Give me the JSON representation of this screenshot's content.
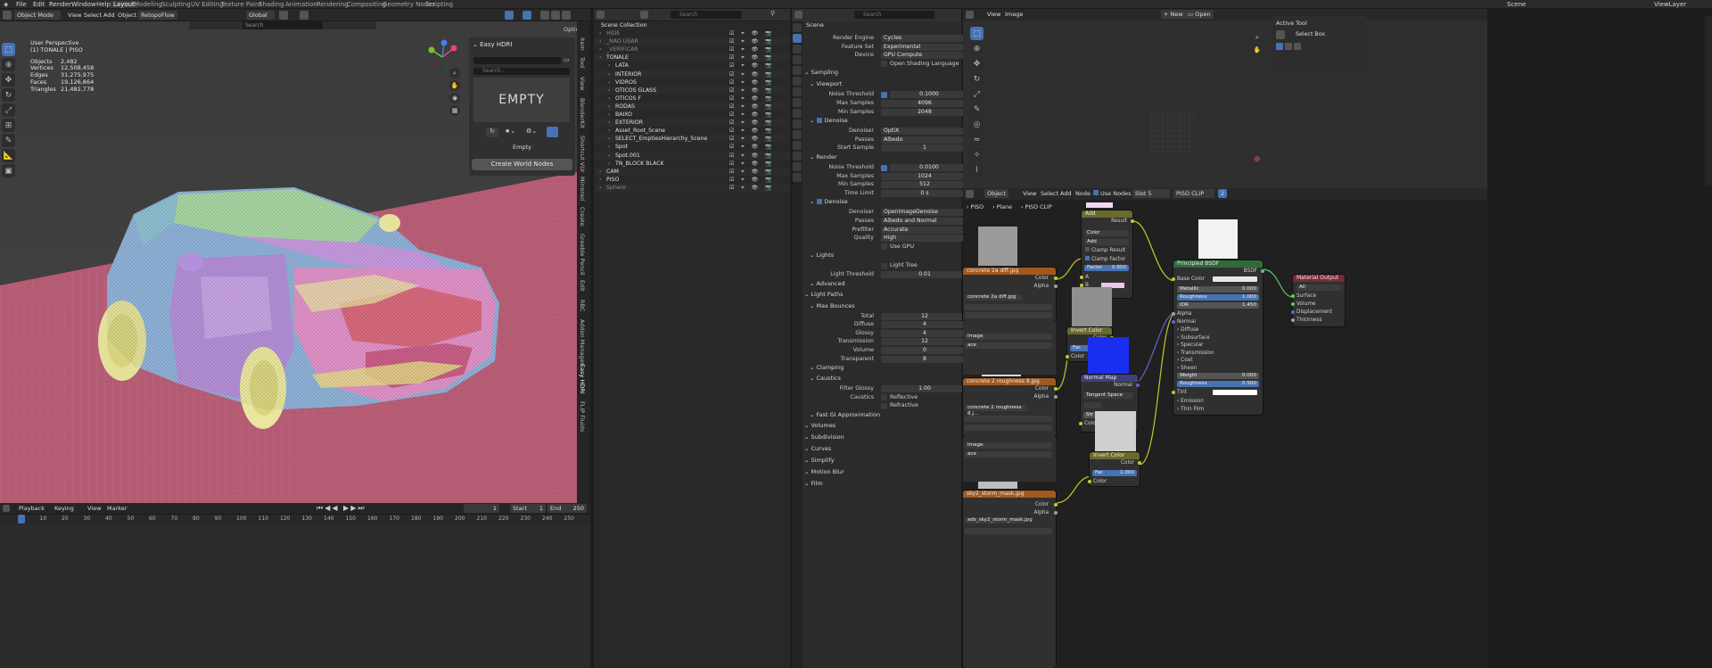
{
  "topbar": {
    "menus": [
      "File",
      "Edit",
      "Render",
      "Window",
      "Help"
    ],
    "tabs": [
      "Layout",
      "Modeling",
      "Sculpting",
      "UV Editing",
      "Texture Paint",
      "Shading",
      "Animation",
      "Rendering",
      "Compositing",
      "Geometry Nodes",
      "Scripting"
    ],
    "active_tab": "Layout",
    "scene": "Scene",
    "view_layer": "ViewLayer"
  },
  "viewport": {
    "mode": "Object Mode",
    "menus": [
      "View",
      "Select",
      "Add",
      "Object"
    ],
    "addon": "RetopoFlow",
    "orientation": "Global",
    "perspective": "User Perspective",
    "collection": "(1) TONALE | PISO",
    "stats": [
      {
        "k": "Objects",
        "v": "2,482"
      },
      {
        "k": "Vertices",
        "v": "12,508,458"
      },
      {
        "k": "Edges",
        "v": "31,275,975"
      },
      {
        "k": "Faces",
        "v": "19,126,864"
      },
      {
        "k": "Triangles",
        "v": "21,482,778"
      }
    ],
    "options": "Options",
    "hdri": {
      "title": "Easy HDRI",
      "search_placeholder": "Search...",
      "preview_text": "EMPTY",
      "name": "Empty",
      "button": "Create World Nodes"
    },
    "side_tabs": [
      "Item",
      "Tool",
      "View",
      "BlenderKit",
      "Shortcut VUr",
      "Mirrored",
      "Create",
      "Greeble Pencil",
      "Edit",
      "RBC",
      "Addon Manager",
      "Easy HDRI",
      "FLIP Fluids"
    ],
    "colors": {
      "mesh_floor": "#d06a8a",
      "accent": "#4772b3"
    }
  },
  "timeline": {
    "menus": [
      "Playback",
      "Keying",
      "View",
      "Marker"
    ],
    "current_frame": "1",
    "start_label": "Start",
    "start": "1",
    "end_label": "End",
    "end": "250",
    "ticks": [
      "1",
      "10",
      "20",
      "30",
      "40",
      "50",
      "60",
      "70",
      "80",
      "90",
      "100",
      "110",
      "120",
      "130",
      "140",
      "150",
      "160",
      "170",
      "180",
      "190",
      "200",
      "210",
      "220",
      "230",
      "240",
      "250"
    ]
  },
  "outliner": {
    "search_placeholder": "Search",
    "root": "Scene Collection",
    "rows": [
      {
        "label": "HIDE",
        "dim": true,
        "indent": 0
      },
      {
        "label": "_NAO USAR",
        "dim": true,
        "indent": 0
      },
      {
        "label": "_VERIFICAR",
        "dim": true,
        "indent": 0
      },
      {
        "label": "TONALE",
        "dim": false,
        "indent": 0
      },
      {
        "label": "LATA",
        "dim": false,
        "indent": 1
      },
      {
        "label": "INTERIOR",
        "dim": false,
        "indent": 1
      },
      {
        "label": "VIDROS",
        "dim": false,
        "indent": 1
      },
      {
        "label": "OTICOS GLASS",
        "dim": false,
        "indent": 1
      },
      {
        "label": "OTICOS F",
        "dim": false,
        "indent": 1
      },
      {
        "label": "RODAS",
        "dim": false,
        "indent": 1
      },
      {
        "label": "BAIXO",
        "dim": false,
        "indent": 1
      },
      {
        "label": "EXTERIOR",
        "dim": false,
        "indent": 1
      },
      {
        "label": "Asset_Root_Scene",
        "dim": false,
        "indent": 1
      },
      {
        "label": "SELECT_EmptiesHierarchy_Scene",
        "dim": false,
        "indent": 1
      },
      {
        "label": "Spot",
        "dim": false,
        "indent": 1
      },
      {
        "label": "Spot.001",
        "dim": false,
        "indent": 1
      },
      {
        "label": "TN_BLOCK BLACK",
        "dim": false,
        "indent": 1
      },
      {
        "label": "CAM",
        "dim": false,
        "indent": 0
      },
      {
        "label": "PISO",
        "dim": false,
        "indent": 0
      },
      {
        "label": "Sphere",
        "dim": true,
        "indent": 0
      }
    ]
  },
  "properties": {
    "search_placeholder": "Search",
    "context": "Scene",
    "rows": [
      {
        "type": "field",
        "label": "Render Engine",
        "value": "Cycles"
      },
      {
        "type": "field",
        "label": "Feature Set",
        "value": "Experimental"
      },
      {
        "type": "field",
        "label": "Device",
        "value": "GPU Compute"
      },
      {
        "type": "check",
        "label": "Open Shading Language",
        "on": false
      },
      {
        "type": "section",
        "label": "Sampling"
      },
      {
        "type": "sub",
        "label": "Viewport"
      },
      {
        "type": "checkfield",
        "label": "Noise Threshold",
        "value": "0.1000"
      },
      {
        "type": "num",
        "label": "Max Samples",
        "value": "4096"
      },
      {
        "type": "num",
        "label": "Min Samples",
        "value": "2048"
      },
      {
        "type": "sub",
        "label": "Denoise",
        "on": true
      },
      {
        "type": "field",
        "label": "Denoiser",
        "value": "OptiX"
      },
      {
        "type": "field",
        "label": "Passes",
        "value": "Albedo"
      },
      {
        "type": "num",
        "label": "Start Sample",
        "value": "1"
      },
      {
        "type": "sub",
        "label": "Render"
      },
      {
        "type": "checkfield",
        "label": "Noise Threshold",
        "value": "0.0100"
      },
      {
        "type": "num",
        "label": "Max Samples",
        "value": "1024"
      },
      {
        "type": "num",
        "label": "Min Samples",
        "value": "512"
      },
      {
        "type": "num",
        "label": "Time Limit",
        "value": "0 s"
      },
      {
        "type": "sub",
        "label": "Denoise",
        "on": true
      },
      {
        "type": "field",
        "label": "Denoiser",
        "value": "OpenImageDenoise"
      },
      {
        "type": "field",
        "label": "Passes",
        "value": "Albedo and Normal"
      },
      {
        "type": "field",
        "label": "Prefilter",
        "value": "Accurate"
      },
      {
        "type": "field",
        "label": "Quality",
        "value": "High"
      },
      {
        "type": "check",
        "label": "Use GPU",
        "on": false
      },
      {
        "type": "sub",
        "label": "Lights"
      },
      {
        "type": "check",
        "label": "Light Tree",
        "on": false
      },
      {
        "type": "num",
        "label": "Light Threshold",
        "value": "0.01"
      },
      {
        "type": "sub",
        "label": "Advanced"
      },
      {
        "type": "section",
        "label": "Light Paths"
      },
      {
        "type": "sub",
        "label": "Max Bounces"
      },
      {
        "type": "num",
        "label": "Total",
        "value": "12"
      },
      {
        "type": "num",
        "label": "Diffuse",
        "value": "4"
      },
      {
        "type": "num",
        "label": "Glossy",
        "value": "4"
      },
      {
        "type": "num",
        "label": "Transmission",
        "value": "12"
      },
      {
        "type": "num",
        "label": "Volume",
        "value": "0"
      },
      {
        "type": "num",
        "label": "Transparent",
        "value": "8"
      },
      {
        "type": "sub",
        "label": "Clamping"
      },
      {
        "type": "sub",
        "label": "Caustics"
      },
      {
        "type": "num",
        "label": "Filter Glossy",
        "value": "1.00"
      },
      {
        "type": "checklabel",
        "label": "Caustics",
        "check": "Reflective"
      },
      {
        "type": "checklabel",
        "label": "",
        "check": "Refractive"
      },
      {
        "type": "sub",
        "label": "Fast GI Approximation"
      },
      {
        "type": "section",
        "label": "Volumes"
      },
      {
        "type": "section",
        "label": "Subdivision"
      },
      {
        "type": "section",
        "label": "Curves"
      },
      {
        "type": "section",
        "label": "Simplify"
      },
      {
        "type": "section",
        "label": "Motion Blur"
      },
      {
        "type": "section",
        "label": "Film"
      }
    ]
  },
  "image_editor": {
    "menus": [
      "View",
      "Image"
    ],
    "new": "New",
    "open": "Open",
    "active_tool_title": "Active Tool",
    "tool": "Select Box"
  },
  "node_editor": {
    "type": "Object",
    "menus": [
      "View",
      "Select",
      "Add",
      "Node"
    ],
    "use_nodes": "Use Nodes",
    "slot": "Slot 5",
    "material": "PISO CLIP",
    "users": "2",
    "breadcrumb": [
      "PISO",
      "Plane",
      "PISO CLIP"
    ],
    "tex1": {
      "title": "concrete 2a diff.jpg",
      "short": "concrete 2a diff.jpg",
      "outs": [
        "Color",
        "Alpha"
      ]
    },
    "tex2": {
      "title": "concrete 2 roughness 8.jpg",
      "short": "concrete 2 roughness 8.j...",
      "outs": [
        "Color",
        "Alpha"
      ],
      "rows": [
        "Image",
        "ace"
      ]
    },
    "tex3": {
      "title": "sky2_storm_mask.jpg",
      "short": "ads_sky2_storm_mask.jpg",
      "outs": [
        "Color",
        "Alpha"
      ],
      "rows": [
        "Image",
        "ace"
      ]
    },
    "add": {
      "title": "Add",
      "out": "Result",
      "rows": [
        "Color",
        "Add"
      ],
      "clamp_result": "Clamp Result",
      "clamp_factor": "Clamp Factor",
      "factor_label": "Factor",
      "factor": "0.850",
      "a": "A",
      "b": "B"
    },
    "invert1": {
      "title": "Invert Color",
      "out": "Color",
      "fac": "Fac",
      "color": "Color"
    },
    "normal_map": {
      "title": "Normal Map",
      "out": "Normal",
      "space": "Tangent Space",
      "strength": "Str",
      "color": "Color"
    },
    "invert2": {
      "title": "Invert Color",
      "out": "Color",
      "fac_label": "Fac",
      "fac": "1.000",
      "color": "Color"
    },
    "bsdf": {
      "title": "Principled BSDF",
      "out": "BSDF",
      "base_color": "Base Color",
      "metallic_label": "Metallic",
      "metallic": "0.000",
      "roughness_label": "Roughness",
      "roughness": "1.000",
      "ior_label": "IOR",
      "ior": "1.450",
      "alpha": "Alpha",
      "normal": "Normal",
      "panels": [
        "Diffuse",
        "Subsurface",
        "Specular",
        "Transmission",
        "Coat",
        "Sheen"
      ],
      "weight_label": "Weight",
      "weight": "0.000",
      "sheen_rough_label": "Roughness",
      "sheen_rough": "0.500",
      "tint": "Tint",
      "panels2": [
        "Emission",
        "Thin Film"
      ]
    },
    "output": {
      "title": "Material Output",
      "target": "All",
      "ins": [
        "Surface",
        "Volume",
        "Displacement",
        "Thickness"
      ]
    }
  }
}
